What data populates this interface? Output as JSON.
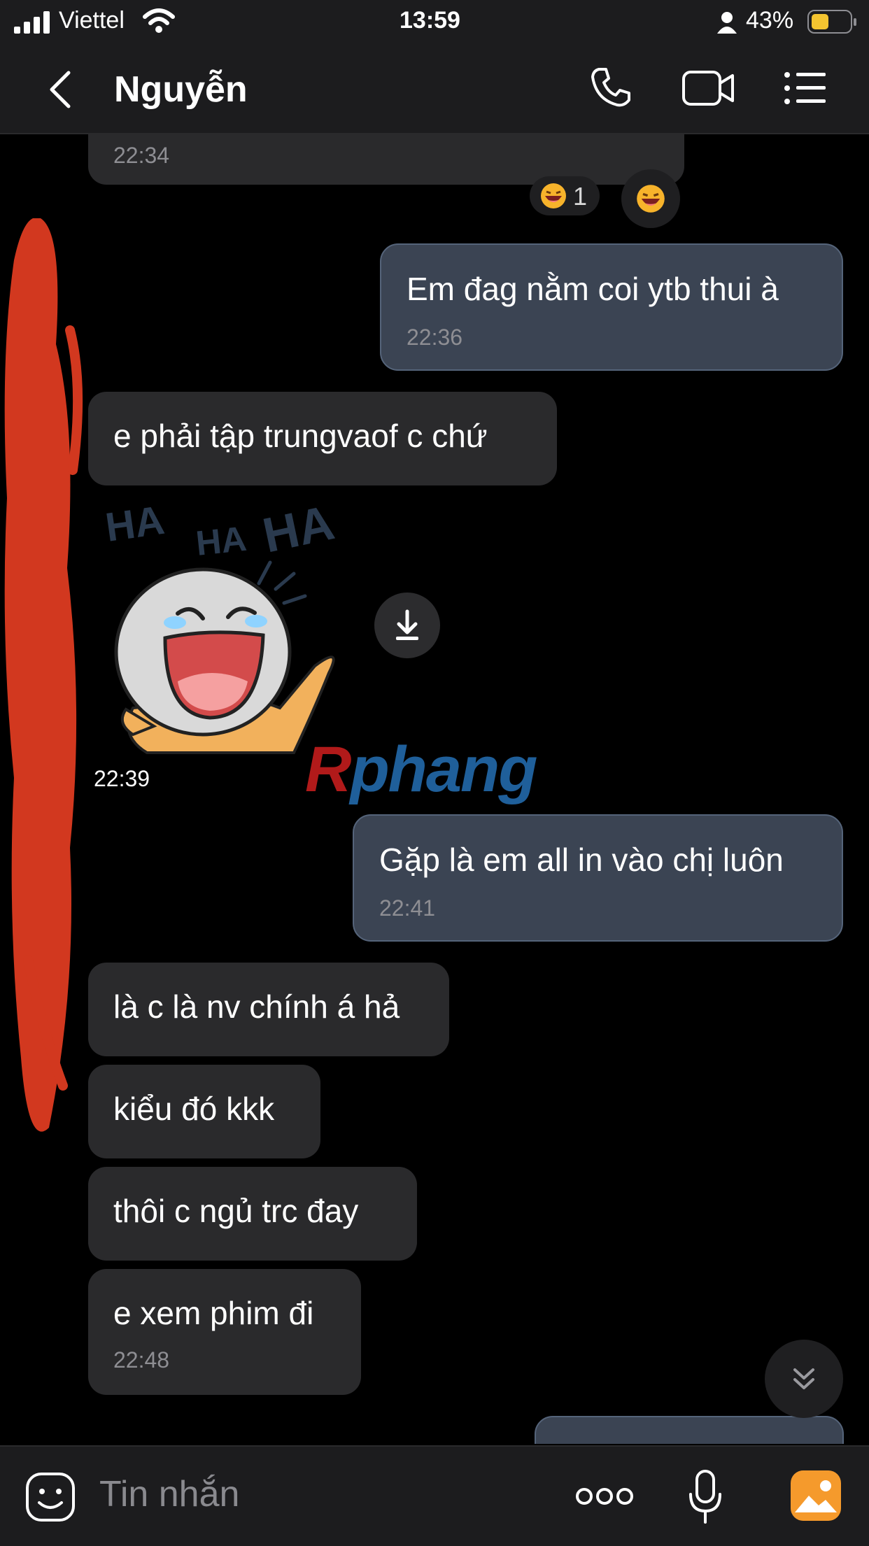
{
  "status": {
    "carrier": "Viettel",
    "time": "13:59",
    "battery": "43%"
  },
  "header": {
    "title": "Nguyễn"
  },
  "messages": [
    {
      "time": "22:34"
    },
    {
      "text": "Em đag nằm coi ytb thui à",
      "time": "22:36"
    },
    {
      "text": "e phải tập trungvaof c chứ"
    },
    {
      "sticker_text": "HA HA HA",
      "time": "22:39"
    },
    {
      "text": "Gặp là em all in vào chị luôn",
      "time": "22:41"
    },
    {
      "text": "là c là nv chính á hả"
    },
    {
      "text": "kiểu đó kkk"
    },
    {
      "text": "thôi c ngủ trc đay"
    },
    {
      "text": "e xem phim đi",
      "time": "22:48"
    }
  ],
  "reactions": {
    "count": "1"
  },
  "watermark": "Rphang",
  "input": {
    "placeholder": "Tin nhắn"
  },
  "colors": {
    "incoming": "#2a2a2c",
    "outgoing": "#3b4453",
    "redaction": "#d2381f"
  },
  "icons": [
    "signal-icon",
    "wifi-icon",
    "person-icon",
    "battery-icon",
    "back-icon",
    "phone-icon",
    "video-icon",
    "menu-icon",
    "download-icon",
    "scroll-down-icon",
    "emoji-icon",
    "more-icon",
    "mic-icon",
    "image-icon"
  ]
}
